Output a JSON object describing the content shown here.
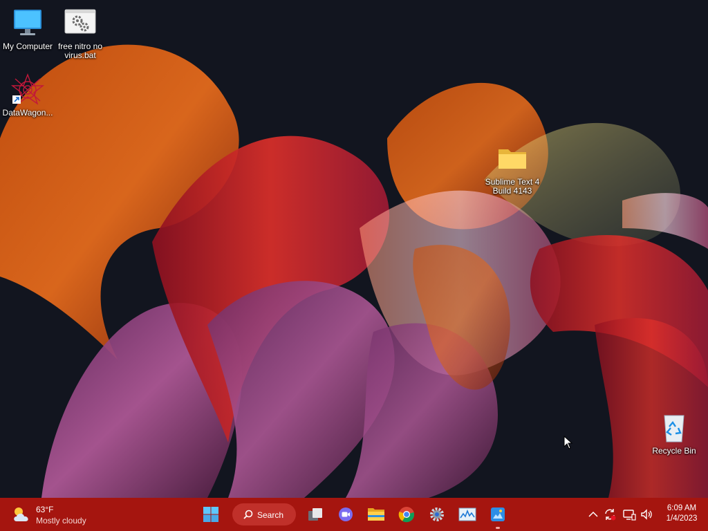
{
  "desktop": {
    "icons": [
      {
        "label": "My Computer",
        "icon": "monitor-icon"
      },
      {
        "label": "free nitro no virus.bat",
        "icon": "batch-file-gear-icon"
      },
      {
        "label": "DataWagon...",
        "icon": "datawagon-shortcut-icon"
      },
      {
        "label": "Sublime Text 4 Build 4143",
        "icon": "folder-icon"
      },
      {
        "label": "Recycle Bin",
        "icon": "recycle-bin-icon"
      }
    ]
  },
  "taskbar": {
    "color": "#a5150f",
    "weather": {
      "temperature": "63°F",
      "condition": "Mostly cloudy",
      "icon": "partly-cloudy-icon"
    },
    "search": {
      "label": "Search",
      "icon": "search-icon"
    },
    "pinned": [
      "windows-start-icon",
      "task-view-icon",
      "teams-chat-icon",
      "file-explorer-icon",
      "chrome-icon",
      "settings-icon",
      "resource-monitor-icon",
      "paint-icon"
    ],
    "tray": [
      "chevron-up-icon",
      "sync-icon",
      "network-icon",
      "volume-icon"
    ],
    "clock": {
      "time": "6:09 AM",
      "date": "1/4/2023"
    }
  }
}
